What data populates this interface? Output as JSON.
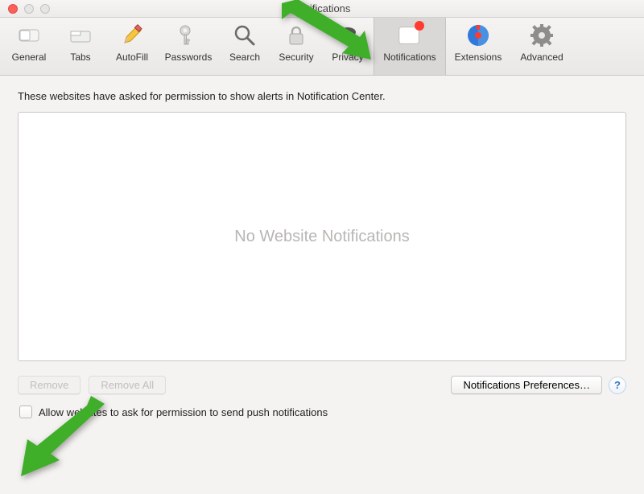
{
  "window": {
    "title": "Notifications"
  },
  "toolbar": {
    "tabs": [
      {
        "label": "General"
      },
      {
        "label": "Tabs"
      },
      {
        "label": "AutoFill"
      },
      {
        "label": "Passwords"
      },
      {
        "label": "Search"
      },
      {
        "label": "Security"
      },
      {
        "label": "Privacy"
      },
      {
        "label": "Notifications"
      },
      {
        "label": "Extensions"
      },
      {
        "label": "Advanced"
      }
    ]
  },
  "main": {
    "description": "These websites have asked for permission to show alerts in Notification Center.",
    "empty_placeholder": "No Website Notifications"
  },
  "buttons": {
    "remove": "Remove",
    "remove_all": "Remove All",
    "notifications_prefs": "Notifications Preferences…"
  },
  "help_icon": "?",
  "checkbox": {
    "checked": false,
    "label": "Allow websites to ask for permission to send push notifications"
  },
  "annotations": {
    "arrow_top_to_tab": true,
    "arrow_bottom_to_checkbox": true
  }
}
